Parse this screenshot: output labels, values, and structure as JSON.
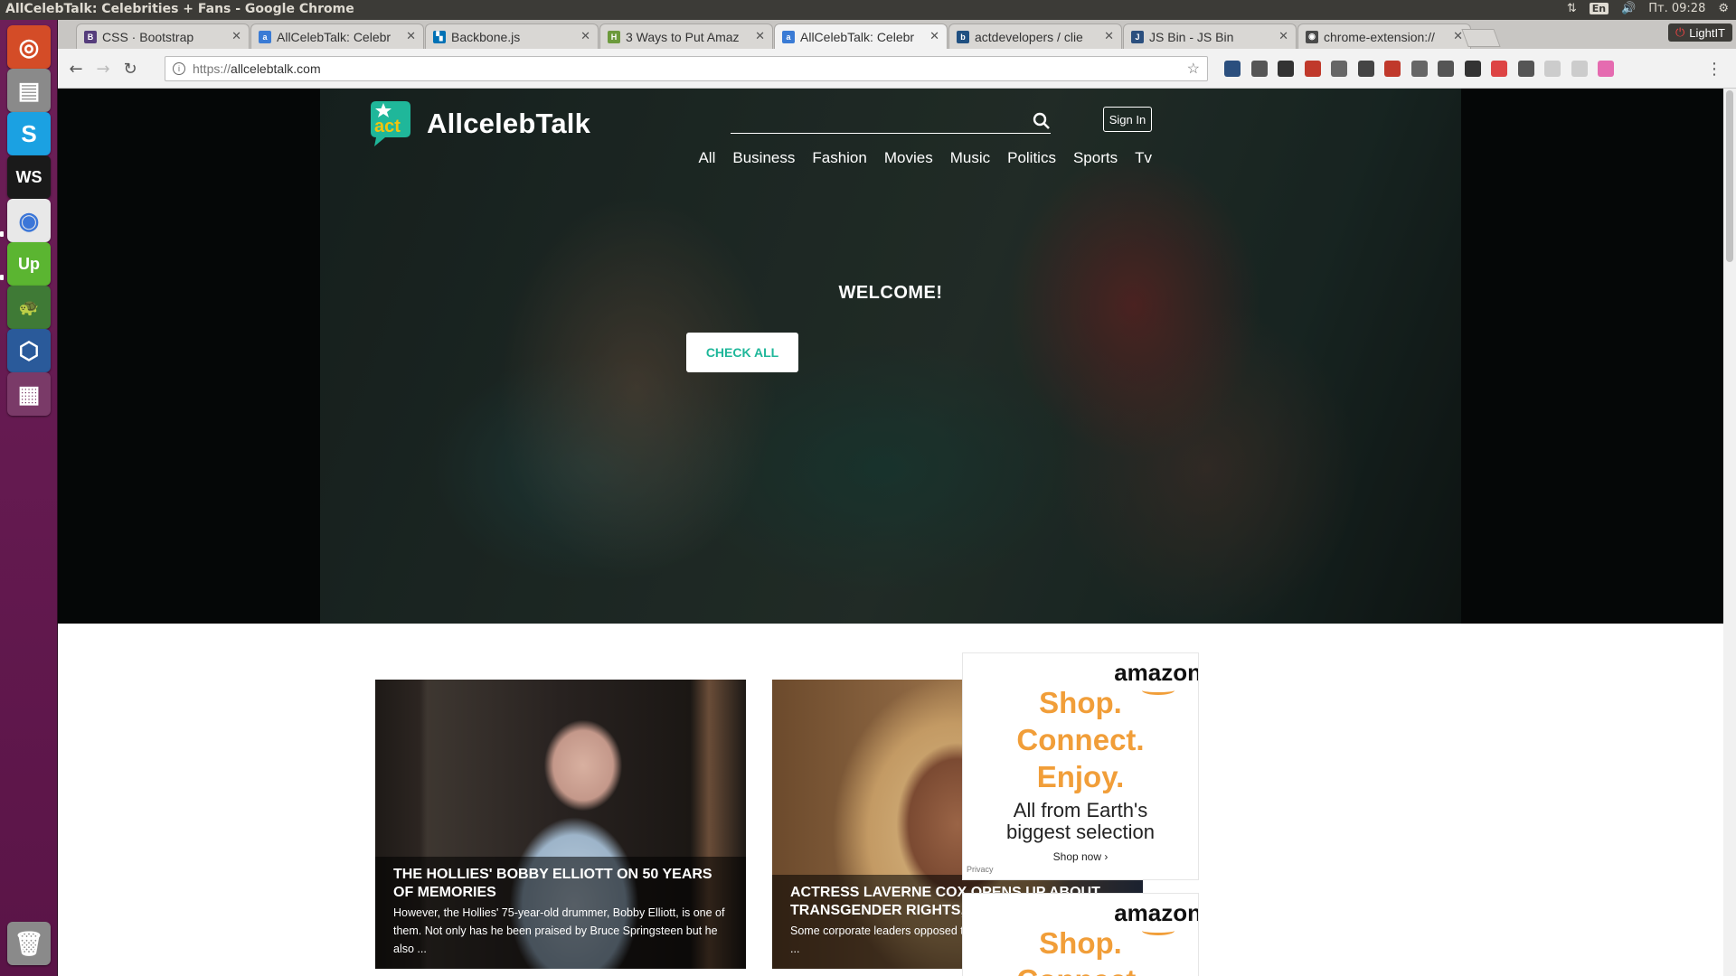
{
  "os": {
    "window_title": "AllCelebTalk: Celebrities + Fans - Google Chrome",
    "lang": "En",
    "clock": "Пт. 09:28"
  },
  "launcher": {
    "items": [
      {
        "name": "ubuntu-dash-icon",
        "color": "#d44c27",
        "glyph": "◎"
      },
      {
        "name": "files-icon",
        "color": "#8a8a8a",
        "glyph": "▤"
      },
      {
        "name": "skype-icon",
        "color": "#1ba1e2",
        "glyph": "S"
      },
      {
        "name": "webstorm-icon",
        "color": "#1a1a1a",
        "glyph": "WS"
      },
      {
        "name": "chrome-icon",
        "color": "#e8e8e8",
        "glyph": "◉"
      },
      {
        "name": "upwork-icon",
        "color": "#5bb531",
        "glyph": "Up"
      },
      {
        "name": "turtle-icon",
        "color": "#3f7a36",
        "glyph": "🐢"
      },
      {
        "name": "virtualbox-icon",
        "color": "#2a5a9a",
        "glyph": "⬡"
      },
      {
        "name": "workspace-switcher-icon",
        "color": "#7a3a68",
        "glyph": "▦"
      }
    ],
    "trash": {
      "name": "trash-icon",
      "color": "#8a8a8a",
      "glyph": "🗑"
    }
  },
  "browser": {
    "tabs": [
      {
        "title": "CSS · Bootstrap",
        "favicon": "B",
        "favicon_color": "#563d7c",
        "active": false
      },
      {
        "title": "AllCelebTalk: Celebr",
        "favicon": "a",
        "favicon_color": "#3a7bd5",
        "active": false
      },
      {
        "title": "Backbone.js",
        "favicon": "▚",
        "favicon_color": "#0071b5",
        "active": false
      },
      {
        "title": "3 Ways to Put Amaz",
        "favicon": "H",
        "favicon_color": "#6c9a3c",
        "active": false
      },
      {
        "title": "AllCelebTalk: Celebr",
        "favicon": "a",
        "favicon_color": "#3a7bd5",
        "active": true
      },
      {
        "title": "actdevelopers / clie",
        "favicon": "b",
        "favicon_color": "#205081",
        "active": false
      },
      {
        "title": "JS Bin - JS Bin",
        "favicon": "J",
        "favicon_color": "#2b4f7e",
        "active": false
      },
      {
        "title": "chrome-extension://",
        "favicon": "◉",
        "favicon_color": "#4a4a4a",
        "active": false
      }
    ],
    "profile_label": "LightIT",
    "url_prefix": "https://",
    "url_host": "allcelebtalk.com"
  },
  "site": {
    "logo_text": "AllcelebTalk",
    "logo_mark": "act",
    "brand_color": "#1fb79a",
    "search_placeholder": "",
    "signin_label": "Sign In",
    "nav": [
      "All",
      "Business",
      "Fashion",
      "Movies",
      "Music",
      "Politics",
      "Sports",
      "Tv"
    ],
    "hero_heading": "WELCOME!",
    "hero_button": "CHECK ALL",
    "cards": [
      {
        "title": "THE HOLLIES' BOBBY ELLIOTT ON 50 YEARS OF MEMORIES",
        "description": "However, the Hollies' 75-year-old drummer, Bobby Elliott, is one of them. Not only has he been praised by Bruce Springsteen but he also ..."
      },
      {
        "title": "ACTRESS LAVERNE COX OPENS UP ABOUT TRANSGENDER RIGHTS, HER NEW ROLE",
        "description": "Some corporate leaders opposed the bill and entertainers including ..."
      }
    ],
    "ads": [
      {
        "brand": "amazon",
        "slogan": [
          "Shop.",
          "Connect.",
          "Enjoy."
        ],
        "sub": [
          "All from Earth's",
          "biggest selection"
        ],
        "cta": "Shop now ›",
        "privacy": "Privacy"
      },
      {
        "brand": "amazon",
        "slogan": [
          "Shop.",
          "Connect."
        ],
        "sub": [],
        "cta": "",
        "privacy": ""
      }
    ]
  }
}
